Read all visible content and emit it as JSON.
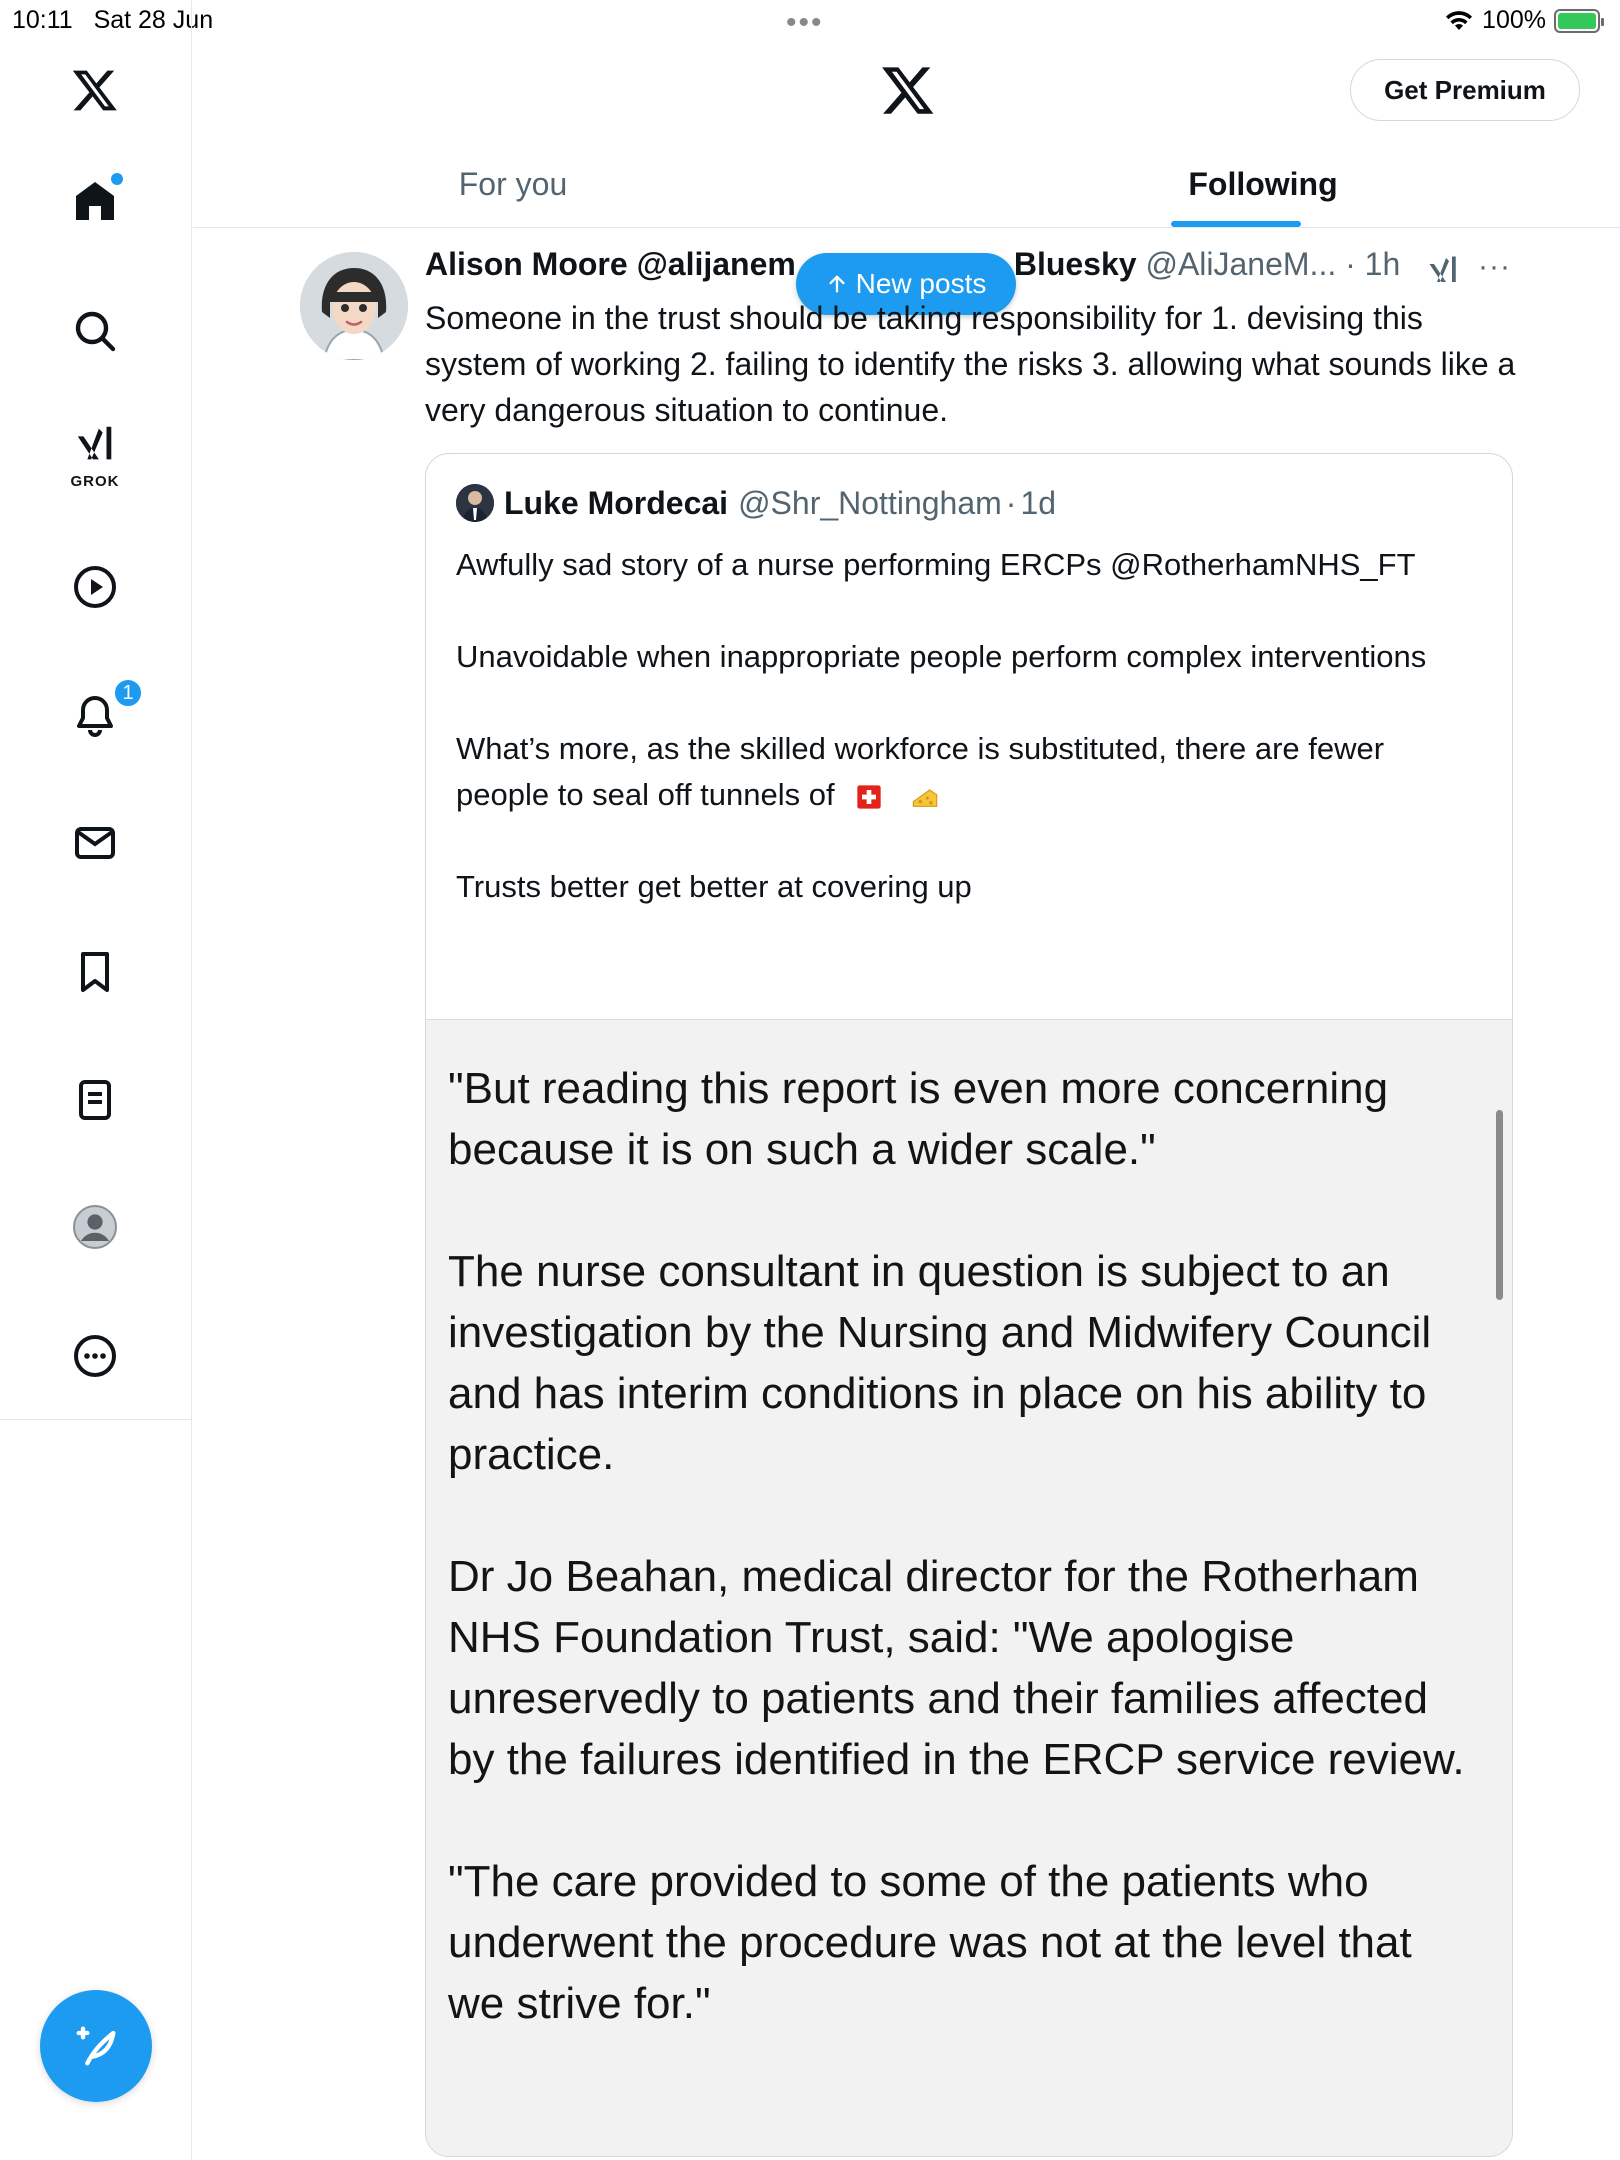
{
  "status_bar": {
    "time": "10:11",
    "date": "Sat 28 Jun",
    "dots": "•••",
    "battery": "100%"
  },
  "sidebar": {
    "grok_label": "GROK",
    "notification_count": "1"
  },
  "header": {
    "premium_button": "Get Premium"
  },
  "tabs": {
    "for_you": "For you",
    "following": "Following"
  },
  "new_posts_pill": "New posts",
  "tweet": {
    "author_name_left": "Alison Moore @alijanem",
    "author_name_right": "Bluesky",
    "handle": "@AliJaneM...",
    "time": "1h",
    "text": "Someone in the trust should be taking responsibility for 1. devising this system of working 2. failing to identify the risks 3. allowing what sounds like a very dangerous situation to continue."
  },
  "quote": {
    "author": "Luke Mordecai",
    "handle": "@Shr_Nottingham",
    "time": "1d",
    "paragraphs": [
      "Awfully sad story of a nurse performing ERCPs @RotherhamNHS_FT",
      "Unavoidable when inappropriate people perform complex interventions",
      "What’s more, as the skilled workforce is substituted, there are fewer people to seal off tunnels of",
      "Trusts better get better at covering up"
    ],
    "image_paragraphs": [
      "\"But reading this report is even more concerning because it is on such a wider scale.\"",
      "The nurse consultant in question is subject to an investigation by the Nursing and Midwifery Council and has interim conditions in place on his ability to practice.",
      "Dr Jo Beahan, medical director for the Rotherham NHS Foundation Trust, said: \"We apologise unreservedly to patients and their families affected by the failures identified in the ERCP service review.",
      "\"The care provided to some of the patients who underwent the procedure was not at the level that we strive for.\""
    ]
  },
  "colors": {
    "accent": "#1d9bf0",
    "text": "#0f1419",
    "muted": "#536471",
    "border": "#cfd9de"
  }
}
